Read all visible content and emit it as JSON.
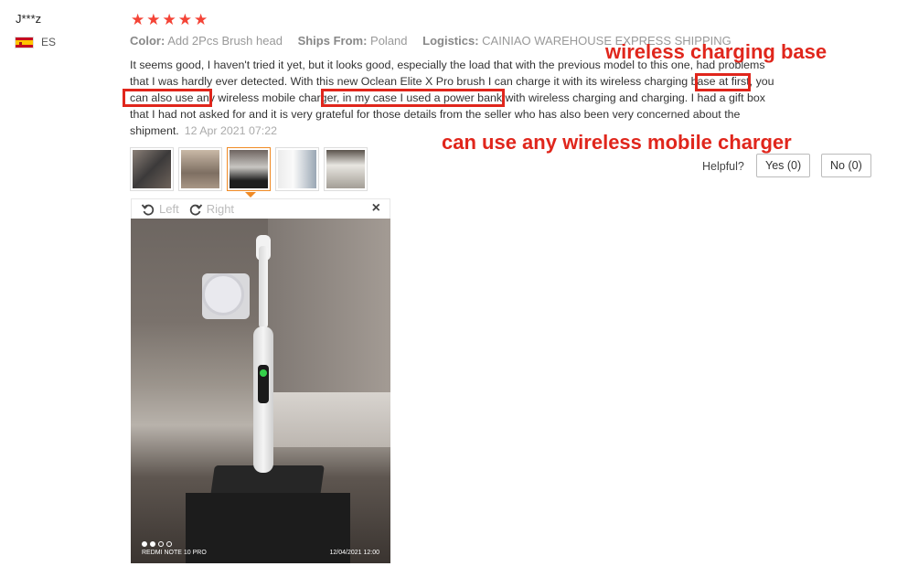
{
  "review": {
    "user": "J***z",
    "country": "ES",
    "stars": [
      "★",
      "★",
      "★",
      "★",
      "★"
    ],
    "color_label": "Color:",
    "color_value": "Add 2Pcs Brush head",
    "ships_label": "Ships From:",
    "ships_value": "Poland",
    "logistics_label": "Logistics:",
    "logistics_value": "CAINIAO WAREHOUSE EXPRESS SHIPPING",
    "text_1": "It seems good, I haven't tried it yet, but it looks good, especially the load that with the previous model to this one, had problems that I was hardly ever detected. With this new Oclean Elite X Pro brush I can charge it with its ",
    "text_hl_1": "wireless charging base",
    "text_2": " at first, you can also ",
    "text_hl_2": "use any wireless mobile charger",
    "text_3": ", in my case I used a power bank with wireless charging and charging. I had a gift box that I had not asked for and it is very grateful for those details from the seller who has also been very concerned about the shipment.",
    "date": "12 Apr 2021 07:22"
  },
  "annotations": {
    "wireless_base": "wireless charging base",
    "wireless_charger": "can use any wireless mobile charger"
  },
  "feedback": {
    "label": "Helpful?",
    "yes": "Yes (0)",
    "no": "No (0)"
  },
  "viewer": {
    "left": "Left",
    "right": "Right",
    "close": "×",
    "watermark_model": "REDMI NOTE 10 PRO",
    "watermark_date": "12/04/2021 12:00"
  },
  "colors": {
    "star": "#f44336",
    "annotation": "#e0261c",
    "active_thumb": "#f08a24"
  }
}
